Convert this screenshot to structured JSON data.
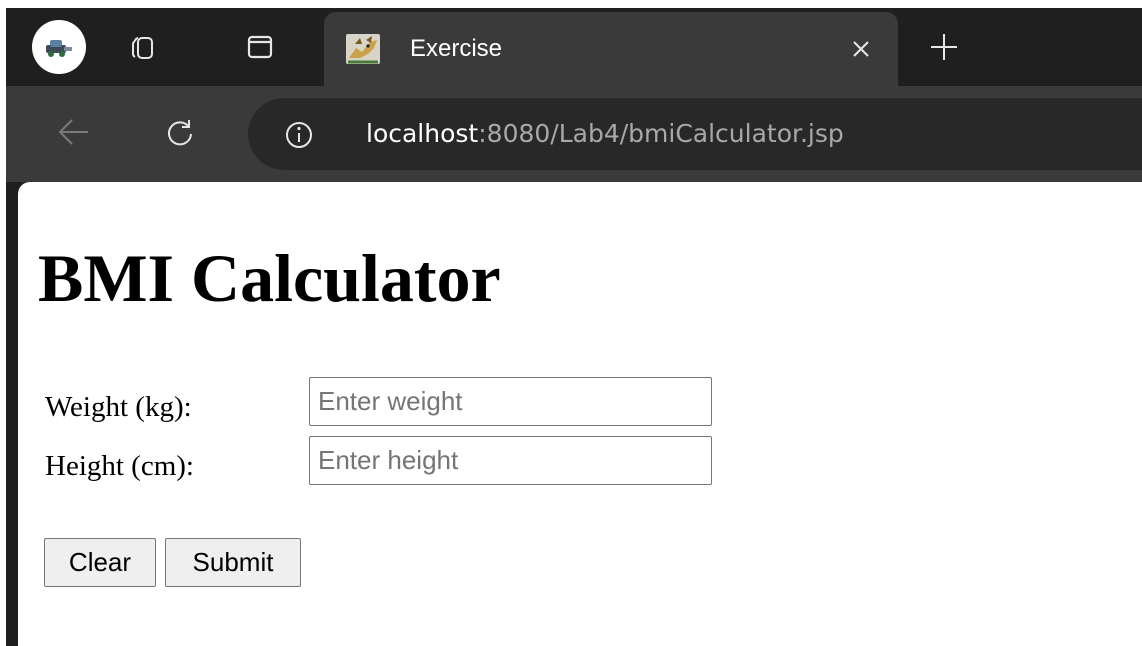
{
  "browser": {
    "tab": {
      "title": "Exercise",
      "favicon": "tomcat-icon"
    },
    "toolbar": {
      "url_host": "localhost",
      "url_path": ":8080/Lab4/bmiCalculator.jsp"
    },
    "icons": {
      "profile": "profile-avatar-icon",
      "collections": "tab-collections-icon",
      "vertical_tabs": "vertical-tabs-icon",
      "close_tab": "close-icon",
      "new_tab": "plus-icon",
      "back": "back-arrow-icon",
      "reload": "reload-icon",
      "site_info": "info-icon"
    },
    "colors": {
      "tabstrip_bg": "#1f1f1f",
      "active_tab_bg": "#3a3a3a",
      "omnibox_bg": "#282828"
    }
  },
  "page": {
    "title": "BMI Calculator",
    "form": {
      "weight": {
        "label": "Weight (kg):",
        "placeholder": "Enter weight",
        "value": ""
      },
      "height": {
        "label": "Height (cm):",
        "placeholder": "Enter height",
        "value": ""
      }
    },
    "buttons": {
      "clear": "Clear",
      "submit": "Submit"
    }
  }
}
